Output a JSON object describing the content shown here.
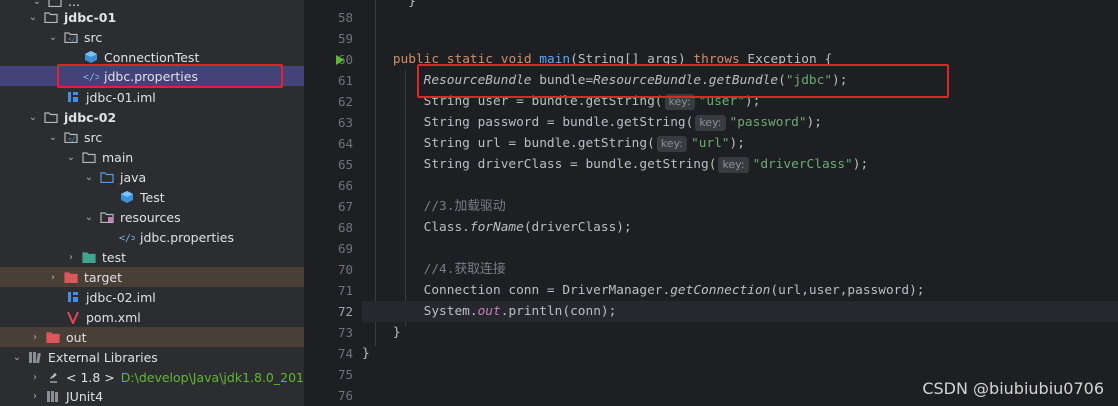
{
  "tree": {
    "rows": [
      {
        "label": "..."
      },
      {
        "label": "jdbc-01"
      },
      {
        "label": "src"
      },
      {
        "label": "ConnectionTest"
      },
      {
        "label": "jdbc.properties"
      },
      {
        "label": "jdbc-01.iml"
      },
      {
        "label": "jdbc-02"
      },
      {
        "label": "src"
      },
      {
        "label": "main"
      },
      {
        "label": "java"
      },
      {
        "label": "Test"
      },
      {
        "label": "resources"
      },
      {
        "label": "jdbc.properties"
      },
      {
        "label": "test"
      },
      {
        "label": "target"
      },
      {
        "label": "jdbc-02.iml"
      },
      {
        "label": "pom.xml"
      },
      {
        "label": "out"
      },
      {
        "label": "External Libraries"
      },
      {
        "label": "< 1.8 >",
        "path": "D:\\develop\\Java\\jdk1.8.0_201"
      },
      {
        "label": "JUnit4"
      }
    ]
  },
  "editor": {
    "line_numbers": [
      "58",
      "59",
      "60",
      "61",
      "62",
      "63",
      "64",
      "65",
      "66",
      "67",
      "68",
      "69",
      "70",
      "71",
      "72",
      "73",
      "74",
      "75",
      "76"
    ],
    "tokens": {
      "public": "public",
      "static": "static",
      "void": "void",
      "main": "main",
      "string_arr": "String[] args",
      "throws": "throws",
      "exception": "Exception",
      "brace_open": "{",
      "brace_close": "}",
      "resource_bundle": "ResourceBundle",
      "bundle_decl": " bundle=",
      "get_bundle": "getBundle",
      "jdbc_str": "\"jdbc\"",
      "string_t": "String",
      "user_var": " user = bundle.",
      "password_var": " password = bundle.",
      "url_var": " url = bundle.",
      "driver_var": " driverClass = bundle.",
      "get_string": "getString",
      "key_hint": "key:",
      "user_str": "\"user\"",
      "password_str": "\"password\"",
      "url_str": "\"url\"",
      "driver_str": "\"driverClass\"",
      "comment_3": "//3.加载驱动",
      "class_t": "Class",
      "for_name": "forName",
      "driver_arg": "(driverClass);",
      "comment_4": "//4.获取连接",
      "connection_t": "Connection",
      "conn_decl": " conn = ",
      "driver_manager": "DriverManager",
      "get_connection": "getConnection",
      "conn_args": "(url,user,password);",
      "system_t": "System",
      "out_field": "out",
      "println": "println",
      "println_args": "(conn);"
    }
  },
  "watermark": "CSDN @biubiubiu0706",
  "colors": {
    "highlight_box": "#e0242b",
    "selection": "#43437a",
    "excluded": "#4a3f36"
  }
}
